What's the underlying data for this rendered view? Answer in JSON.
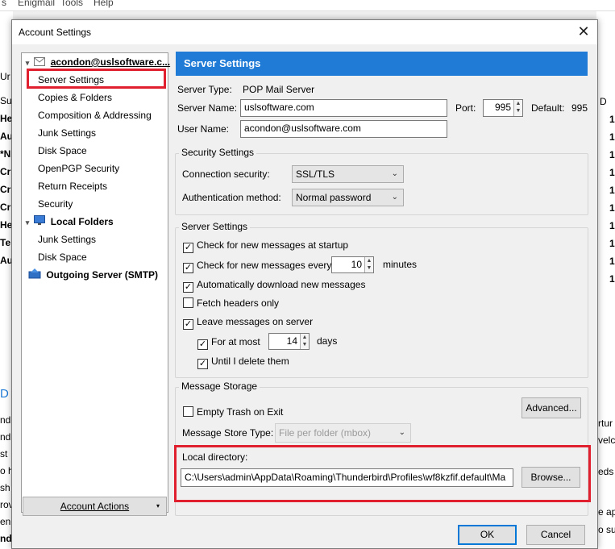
{
  "background": {
    "menu": [
      "s",
      "Enigmail",
      "Tools",
      "Help"
    ],
    "left_fragments": [
      "Ur",
      "Su",
      "He",
      "Au",
      "*N",
      "Cr",
      "Cr",
      "Cr",
      "He",
      "Te",
      "Au",
      "D",
      "nd",
      "nd",
      "st",
      "o h",
      "sh",
      "rov",
      "en",
      "nd"
    ],
    "right_fragments": [
      "D",
      "1",
      "1",
      "1",
      "1",
      "1",
      "1",
      "1",
      "1",
      "1",
      "1",
      "rtur",
      "velc",
      "eds",
      "e ap",
      "o su"
    ]
  },
  "dialog": {
    "title": "Account Settings",
    "close_glyph": "✕"
  },
  "tree": {
    "account": "acondon@uslsoftware.c...",
    "account_items": [
      "Server Settings",
      "Copies & Folders",
      "Composition & Addressing",
      "Junk Settings",
      "Disk Space",
      "OpenPGP Security",
      "Return Receipts",
      "Security"
    ],
    "local_folders": "Local Folders",
    "local_items": [
      "Junk Settings",
      "Disk Space"
    ],
    "outgoing": "Outgoing Server (SMTP)",
    "account_actions": "Account Actions"
  },
  "server": {
    "header": "Server Settings",
    "server_type_label": "Server Type:",
    "server_type_value": "POP Mail Server",
    "server_name_label": "Server Name:",
    "server_name_value": "uslsoftware.com",
    "port_label": "Port:",
    "port_value": "995",
    "default_label": "Default:",
    "default_value": "995",
    "user_name_label": "User Name:",
    "user_name_value": "acondon@uslsoftware.com"
  },
  "security": {
    "legend": "Security Settings",
    "connection_label": "Connection security:",
    "connection_value": "SSL/TLS",
    "auth_label": "Authentication method:",
    "auth_value": "Normal password"
  },
  "server_settings": {
    "legend": "Server Settings",
    "check_startup": "Check for new messages at startup",
    "check_every": "Check for new messages every",
    "check_every_value": "10",
    "minutes": "minutes",
    "auto_download": "Automatically download new messages",
    "fetch_headers": "Fetch headers only",
    "leave_on_server": "Leave messages on server",
    "for_at_most": "For at most",
    "for_at_most_value": "14",
    "days": "days",
    "until_delete": "Until I delete them"
  },
  "storage": {
    "legend": "Message Storage",
    "empty_trash": "Empty Trash on Exit",
    "advanced": "Advanced...",
    "store_type_label": "Message Store Type:",
    "store_type_value": "File per folder (mbox)",
    "local_dir_label": "Local directory:",
    "local_dir_value": "C:\\Users\\admin\\AppData\\Roaming\\Thunderbird\\Profiles\\wf8kzfif.default\\Ma",
    "browse": "Browse..."
  },
  "footer": {
    "ok": "OK",
    "cancel": "Cancel"
  },
  "colors": {
    "header_blue": "#1f7bd6",
    "highlight_red": "#e0202e"
  }
}
